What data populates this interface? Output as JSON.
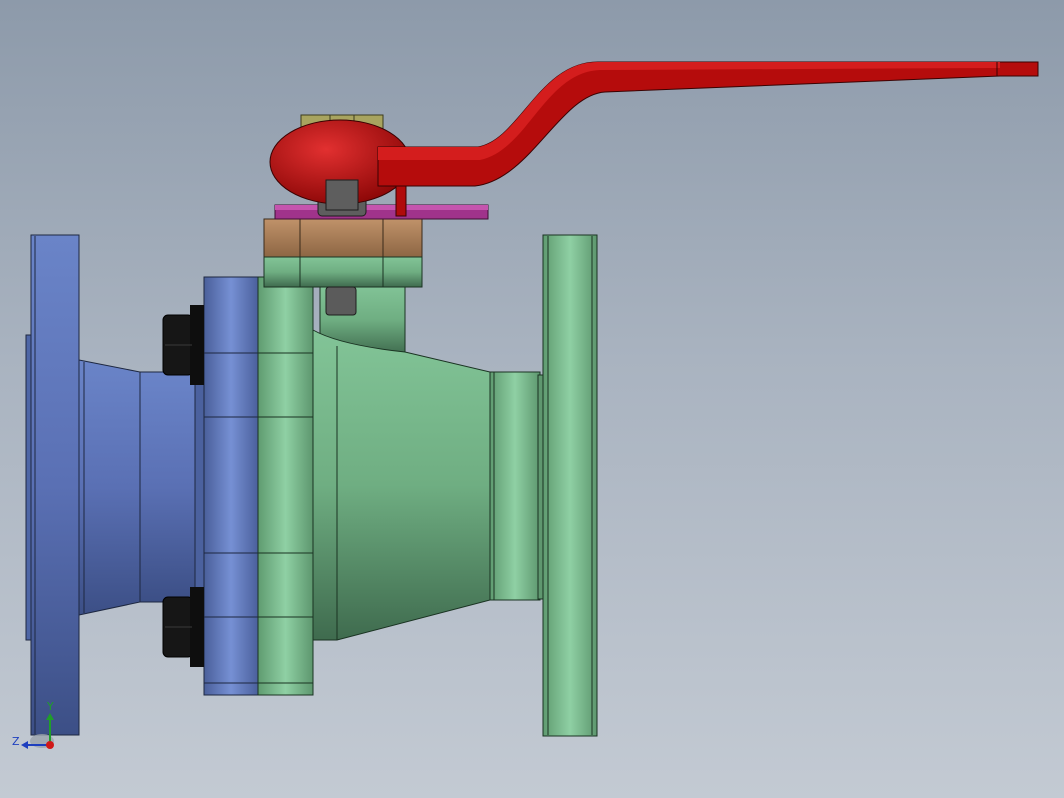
{
  "triad": {
    "y_label": "Y",
    "z_label": "Z",
    "y_color": "#1f9e2a",
    "z_color": "#1e3fbf",
    "x_color": "#d01818"
  },
  "colors": {
    "viewport_top": "#8d9aaa",
    "viewport_bottom": "#c3cad3",
    "flange_blue": "#5b74b8",
    "body_green": "#79b98a",
    "handle_red": "#b80d0d",
    "gland_bronze": "#a97d56",
    "stop_plate_magenta": "#9b2f86",
    "stem_nut_olive": "#a6a25d",
    "bolt_black": "#1a1a1a"
  },
  "parts": [
    {
      "id": "left-flange",
      "icon": "flange-shape"
    },
    {
      "id": "right-flange",
      "icon": "flange-shape"
    },
    {
      "id": "valve-body",
      "icon": "body-shape"
    },
    {
      "id": "lever-handle",
      "icon": "lever-shape"
    },
    {
      "id": "stem-nut",
      "icon": "nut-shape"
    },
    {
      "id": "gland",
      "icon": "gland-shape"
    },
    {
      "id": "stop-plate",
      "icon": "plate-shape"
    },
    {
      "id": "flange-bolts",
      "icon": "bolt-shape"
    }
  ]
}
